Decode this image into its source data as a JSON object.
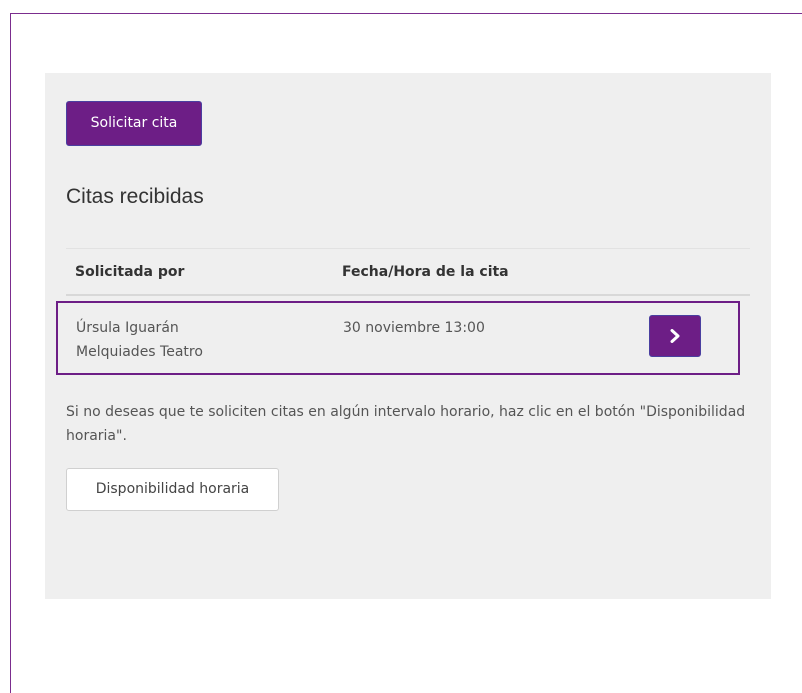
{
  "actions": {
    "request_appointment_label": "Solicitar cita",
    "availability_label": "Disponibilidad horaria"
  },
  "section": {
    "title": "Citas recibidas"
  },
  "table": {
    "headers": {
      "requested_by": "Solicitada por",
      "datetime": "Fecha/Hora de la cita"
    },
    "rows": [
      {
        "name": "Úrsula Iguarán",
        "organization": "Melquiades Teatro",
        "datetime": "30 noviembre 13:00",
        "action_icon": "chevron-right-icon"
      }
    ]
  },
  "info": {
    "text": "Si no deseas que te soliciten citas en algún intervalo horario, haz clic en el botón \"Disponibilidad horaria\"."
  },
  "colors": {
    "primary": "#6d1e86",
    "panel_background": "#efefef"
  }
}
